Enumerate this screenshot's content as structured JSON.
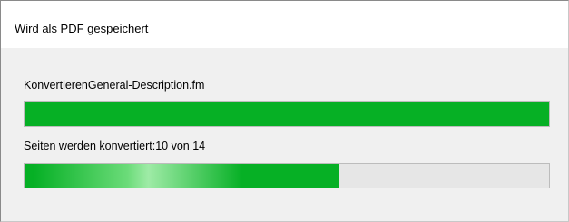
{
  "dialog": {
    "title": "Wird als PDF gespeichert"
  },
  "file": {
    "name": "KonvertierenGeneral-Description.fm",
    "progress_fraction": 1.0
  },
  "pages": {
    "status_text": "Seiten werden konvertiert:10 von 14",
    "current": 10,
    "total": 14,
    "progress_fraction": 0.6
  },
  "colors": {
    "progress_fill": "#06b025",
    "progress_track": "#e6e6e6",
    "title_background": "#ffffff",
    "dialog_background": "#f0f0f0"
  }
}
